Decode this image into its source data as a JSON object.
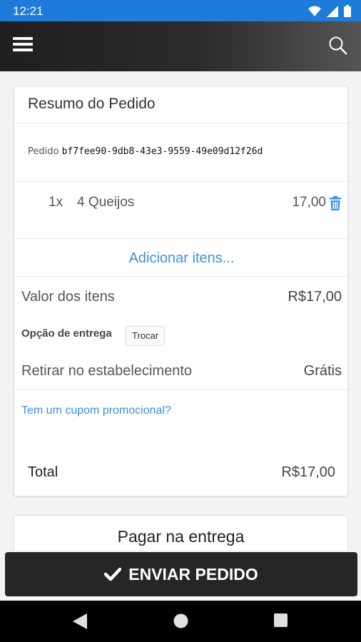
{
  "status_bar": {
    "time": "12:21"
  },
  "app_bar": {
    "menu_icon": "hamburger-menu-icon",
    "search_icon": "search-icon"
  },
  "order_summary": {
    "title": "Resumo do Pedido",
    "order_label": "Pedido",
    "order_id": "bf7fee90-9db8-43e3-9559-49e09d12f26d",
    "items": [
      {
        "qty": "1x",
        "name": "4 Queijos",
        "price": "17,00"
      }
    ],
    "add_items_label": "Adicionar itens...",
    "items_value_label": "Valor dos itens",
    "items_value": "R$17,00",
    "delivery_option_label": "Opção de entrega",
    "change_button_label": "Trocar",
    "pickup_label": "Retirar no estabelecimento",
    "pickup_value": "Grátis",
    "coupon_link": "Tem um cupom promocional?",
    "total_label": "Total",
    "total_value": "R$17,00"
  },
  "payment": {
    "title": "Pagar na entrega"
  },
  "send_button": {
    "label": "ENVIAR PEDIDO"
  },
  "colors": {
    "accent": "#3d8fe0",
    "status_bar": "#1e7bd9",
    "button": "#262626"
  }
}
